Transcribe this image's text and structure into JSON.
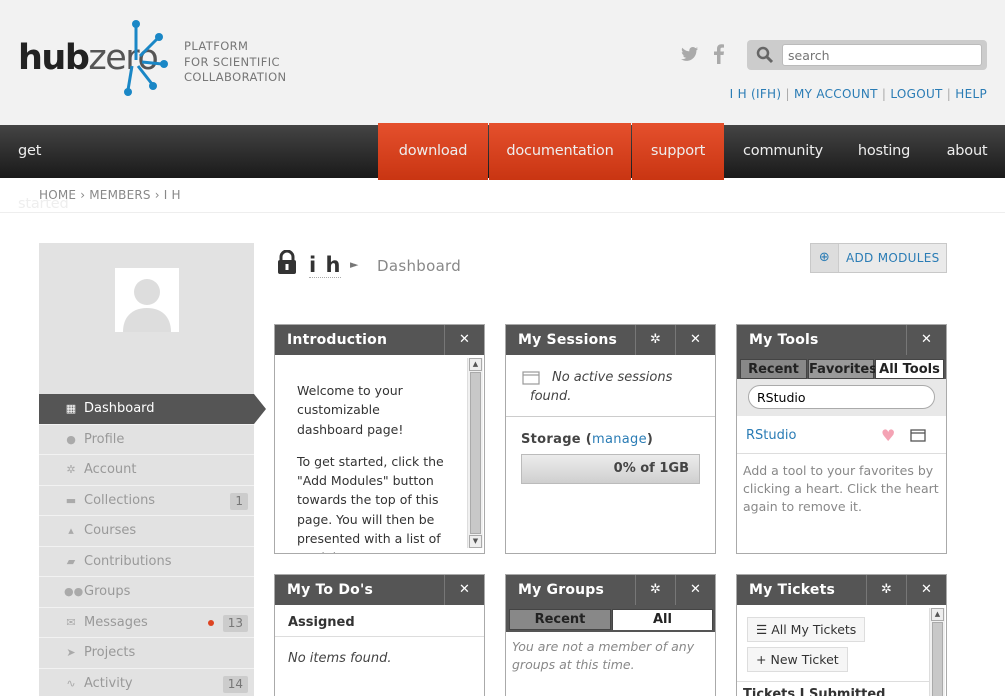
{
  "header": {
    "logo_hub": "hub",
    "logo_zero": "zero",
    "tagline": [
      "PLATFORM",
      "FOR SCIENTIFIC",
      "COLLABORATION"
    ],
    "search_placeholder": "search",
    "user_links": [
      "I H (IFH)",
      "MY ACCOUNT",
      "LOGOUT",
      "HELP"
    ]
  },
  "nav": {
    "items": [
      "get started",
      "download",
      "documentation",
      "support",
      "community",
      "hosting",
      "about"
    ]
  },
  "breadcrumb": [
    "HOME",
    "MEMBERS",
    "I H"
  ],
  "sidebar": {
    "menu": [
      {
        "label": "Dashboard",
        "icon": "grid-icon"
      },
      {
        "label": "Profile",
        "icon": "user-icon"
      },
      {
        "label": "Account",
        "icon": "cogs-icon"
      },
      {
        "label": "Collections",
        "icon": "archive-icon",
        "count": "1"
      },
      {
        "label": "Courses",
        "icon": "graduation-cap-icon"
      },
      {
        "label": "Contributions",
        "icon": "book-icon"
      },
      {
        "label": "Groups",
        "icon": "group-icon"
      },
      {
        "label": "Messages",
        "icon": "envelope-icon",
        "count": "13"
      },
      {
        "label": "Projects",
        "icon": "paper-plane-icon"
      },
      {
        "label": "Activity",
        "icon": "pulse-icon",
        "count": "14"
      }
    ]
  },
  "page": {
    "name": "i h",
    "sub": "Dashboard",
    "add_modules": "ADD MODULES"
  },
  "modules": {
    "introduction": {
      "title": "Introduction",
      "p1": "Welcome to your customizable dashboard page!",
      "p2": "To get started, click the \"Add Modules\" button towards the top of this page. You will then be presented with a list of modules"
    },
    "sessions": {
      "title": "My Sessions",
      "empty": "No active sessions found.",
      "storage_label": "Storage",
      "manage": "manage",
      "storage_value": "0% of 1GB",
      "storage_fraction": 0
    },
    "tools": {
      "title": "My Tools",
      "tabs": [
        "Recent",
        "Favorites",
        "All Tools"
      ],
      "search_value": "RStudio",
      "result": "RStudio",
      "help": "Add a tool to your favorites by clicking a heart. Click the heart again to remove it."
    },
    "todos": {
      "title": "My To Do's",
      "section": "Assigned",
      "empty": "No items found."
    },
    "groups": {
      "title": "My Groups",
      "tabs": [
        "Recent",
        "All"
      ],
      "empty": "You are not a member of any groups at this time."
    },
    "tickets": {
      "title": "My Tickets",
      "btn_all": "All My Tickets",
      "btn_new": "New Ticket",
      "section": "Tickets I Submitted"
    }
  },
  "colors": {
    "accent_red": "#d13f1b",
    "link_blue": "#2a7cb5",
    "nav_dark": "#222222"
  }
}
